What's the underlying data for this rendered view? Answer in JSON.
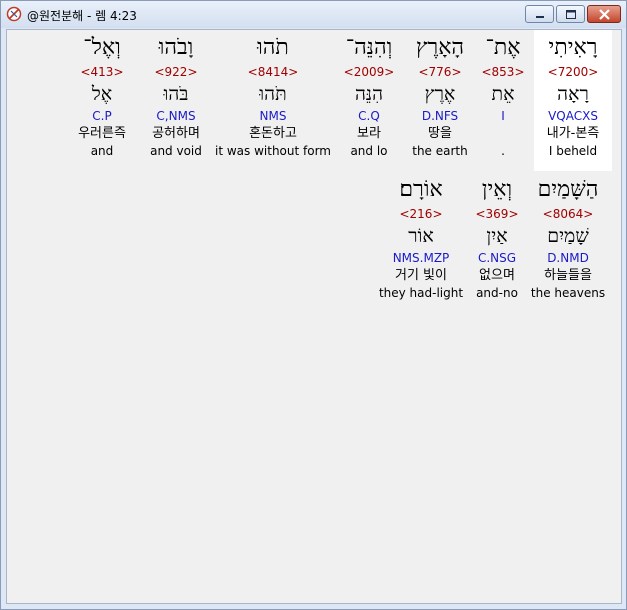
{
  "window": {
    "title": "@원전분해 - 렘 4:23",
    "icon": "app-icon"
  },
  "rows": [
    {
      "words": [
        {
          "heb": "רָאִיתִי",
          "strong": "<7200>",
          "lex": "רָאָה",
          "parse": "VQACXS",
          "kor": "내가-본즉",
          "eng": "I beheld",
          "selected": true
        },
        {
          "heb": "אֶת־",
          "strong": "<853>",
          "lex": "אֵת",
          "parse": "I",
          "kor": "",
          "eng": "."
        },
        {
          "heb": "הָאָרֶץ",
          "strong": "<776>",
          "lex": "אֶרֶץ",
          "parse": "D.NFS",
          "kor": "땅을",
          "eng": "the earth"
        },
        {
          "heb": "וְהִנֵּה־",
          "strong": "<2009>",
          "lex": "הִנֵּה",
          "parse": "C.Q",
          "kor": "보라",
          "eng": "and lo"
        },
        {
          "heb": "תֹהוּ",
          "strong": "<8414>",
          "lex": "תֹּהוּ",
          "parse": "NMS",
          "kor": "혼돈하고",
          "eng": "it was without form"
        },
        {
          "heb": "וָבֹהוּ",
          "strong": "<922>",
          "lex": "בֹּהוּ",
          "parse": "C,NMS",
          "kor": "공허하며",
          "eng": "and void"
        },
        {
          "heb": "וְאֶל־",
          "strong": "<413>",
          "lex": "אֶל",
          "parse": "C.P",
          "kor": "우러른즉",
          "eng": "and"
        }
      ]
    },
    {
      "words": [
        {
          "heb": "הַשָּׁמַיִם",
          "strong": "<8064>",
          "lex": "שָׁמַיִם",
          "parse": "D.NMD",
          "kor": "하늘들을",
          "eng": "the heavens"
        },
        {
          "heb": "וְאֵין",
          "strong": "<369>",
          "lex": "אַיִן",
          "parse": "C.NSG",
          "kor": "없으며",
          "eng": "and-no"
        },
        {
          "heb": "אוֹרָם׃",
          "strong": "<216>",
          "lex": "אוֹר",
          "parse": "NMS.MZP",
          "kor": "거기 빛이",
          "eng": "they had-light"
        }
      ]
    }
  ]
}
